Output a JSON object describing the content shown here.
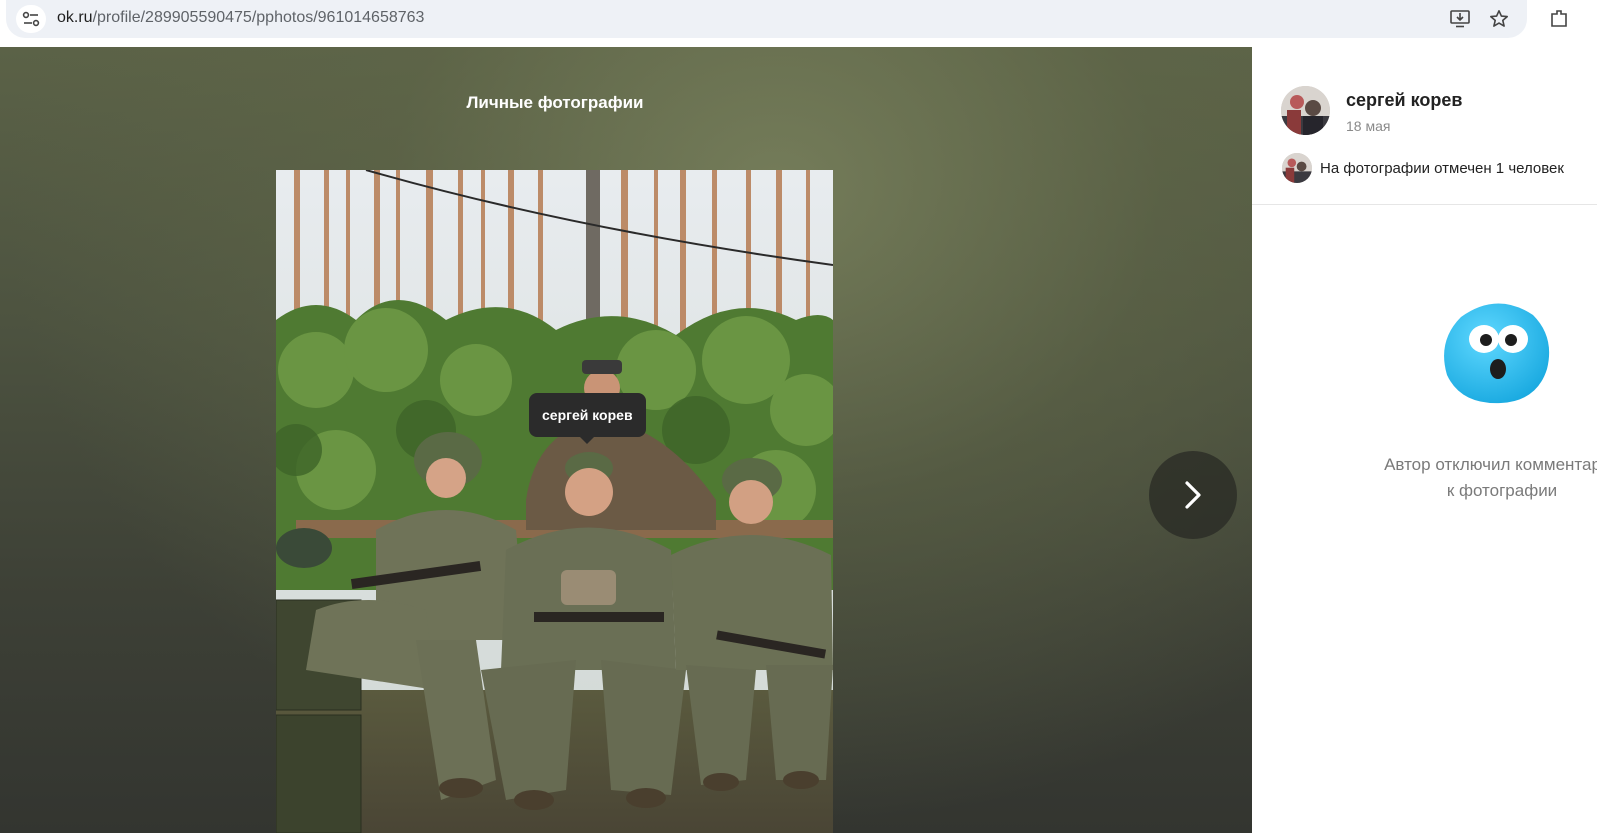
{
  "browser": {
    "url_host": "ok.ru",
    "url_path": "/profile/289905590475/pphotos/961014658763"
  },
  "viewer": {
    "album_title": "Личные фотографии",
    "photo_tag": "сергей корев"
  },
  "side_panel": {
    "author_name": "сергей корев",
    "post_date": "18 мая",
    "tagged_text": "На фотографии отмечен 1 человек",
    "comments_disabled_line1": "Автор отключил комментарии",
    "comments_disabled_line2": "к фотографии"
  },
  "colors": {
    "viewer_bg": "#4d5340",
    "emoji_blue": "#2cc3f0"
  },
  "icons": [
    "site-info-icon",
    "install-app-icon",
    "bookmark-star-icon",
    "extensions-icon",
    "chevron-right-icon",
    "surprised-emoji-icon"
  ]
}
